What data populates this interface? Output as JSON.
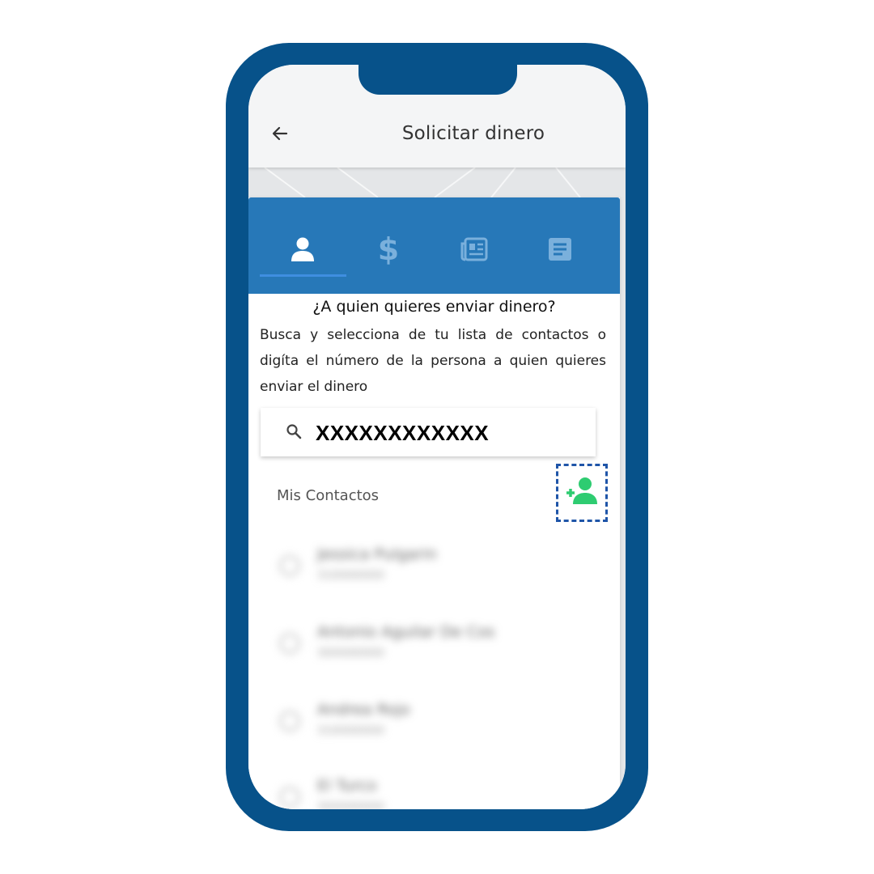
{
  "colors": {
    "frame": "#07528a",
    "tab_bar": "#2778b8",
    "tab_active_icon": "#ffffff",
    "tab_inactive_icon": "#7ab0dc",
    "add_contact_icon": "#2ecc71",
    "highlight_border": "#1f55a8"
  },
  "appbar": {
    "back_icon": "arrow-left-icon",
    "title": "Solicitar dinero"
  },
  "tabs": [
    {
      "icon": "person-icon",
      "active": true
    },
    {
      "icon": "dollar-icon",
      "active": false
    },
    {
      "icon": "newspaper-icon",
      "active": false
    },
    {
      "icon": "document-icon",
      "active": false
    }
  ],
  "main": {
    "question": "¿A quien quieres enviar dinero?",
    "instructions": "Busca y selecciona de tu lista de contactos o digíta el número de la persona a quien quieres enviar el dinero"
  },
  "search": {
    "icon": "search-icon",
    "value": "XXXXXXXXXXXX"
  },
  "contacts": {
    "section_label": "Mis Contactos",
    "add_icon": "add-contact-icon",
    "items": [
      {
        "name": "Jessica Pulgarin",
        "phone": "3100000000"
      },
      {
        "name": "Antonio Aguilar De Cos",
        "phone": "3000000000"
      },
      {
        "name": "Andrea Rojo",
        "phone": "3100000000"
      },
      {
        "name": "El Turco",
        "phone": "3000000000"
      }
    ]
  }
}
